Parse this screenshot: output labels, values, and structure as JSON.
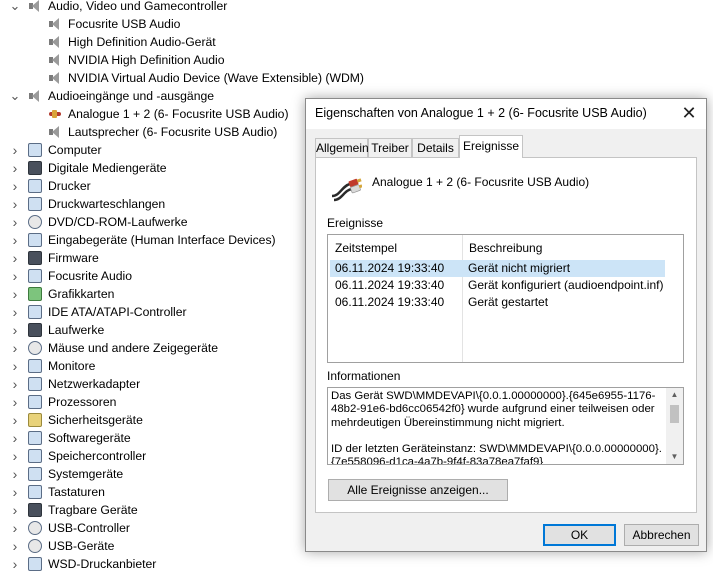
{
  "tree": {
    "items": [
      {
        "label": "Audio, Video und Gamecontroller",
        "chevron": "expanded",
        "icon": "speaker-icon"
      },
      {
        "label": "Focusrite USB Audio",
        "icon": "speaker-icon"
      },
      {
        "label": "High Definition Audio-Gerät",
        "icon": "speaker-icon"
      },
      {
        "label": "NVIDIA High Definition Audio",
        "icon": "speaker-icon"
      },
      {
        "label": "NVIDIA Virtual Audio Device (Wave Extensible) (WDM)",
        "icon": "speaker-icon"
      },
      {
        "label": "Audioeingänge und -ausgänge",
        "chevron": "expanded",
        "icon": "speaker-icon"
      },
      {
        "label": "Analogue 1 + 2 (6- Focusrite USB Audio)",
        "icon": "audio-cable-icon"
      },
      {
        "label": "Lautsprecher (6- Focusrite USB Audio)",
        "icon": "speaker-icon"
      },
      {
        "label": "Computer",
        "chevron": "collapsed",
        "icon": "monitor-icon"
      },
      {
        "label": "Digitale Mediengeräte",
        "chevron": "collapsed",
        "icon": "media-device-icon"
      },
      {
        "label": "Drucker",
        "chevron": "collapsed",
        "icon": "printer-icon"
      },
      {
        "label": "Druckwarteschlangen",
        "chevron": "collapsed",
        "icon": "print-queue-icon"
      },
      {
        "label": "DVD/CD-ROM-Laufwerke",
        "chevron": "collapsed",
        "icon": "disc-drive-icon"
      },
      {
        "label": "Eingabegeräte (Human Interface Devices)",
        "chevron": "collapsed",
        "icon": "hid-icon"
      },
      {
        "label": "Firmware",
        "chevron": "collapsed",
        "icon": "firmware-icon"
      },
      {
        "label": "Focusrite Audio",
        "chevron": "collapsed",
        "icon": "monitor-icon"
      },
      {
        "label": "Grafikkarten",
        "chevron": "collapsed",
        "icon": "graphics-card-icon"
      },
      {
        "label": "IDE ATA/ATAPI-Controller",
        "chevron": "collapsed",
        "icon": "ide-controller-icon"
      },
      {
        "label": "Laufwerke",
        "chevron": "collapsed",
        "icon": "disk-drive-icon"
      },
      {
        "label": "Mäuse und andere Zeigegeräte",
        "chevron": "collapsed",
        "icon": "mouse-icon"
      },
      {
        "label": "Monitore",
        "chevron": "collapsed",
        "icon": "monitor-icon"
      },
      {
        "label": "Netzwerkadapter",
        "chevron": "collapsed",
        "icon": "network-adapter-icon"
      },
      {
        "label": "Prozessoren",
        "chevron": "collapsed",
        "icon": "processor-icon"
      },
      {
        "label": "Sicherheitsgeräte",
        "chevron": "collapsed",
        "icon": "security-device-icon"
      },
      {
        "label": "Softwaregeräte",
        "chevron": "collapsed",
        "icon": "software-device-icon"
      },
      {
        "label": "Speichercontroller",
        "chevron": "collapsed",
        "icon": "storage-controller-icon"
      },
      {
        "label": "Systemgeräte",
        "chevron": "collapsed",
        "icon": "system-device-icon"
      },
      {
        "label": "Tastaturen",
        "chevron": "collapsed",
        "icon": "keyboard-icon"
      },
      {
        "label": "Tragbare Geräte",
        "chevron": "collapsed",
        "icon": "portable-device-icon"
      },
      {
        "label": "USB-Controller",
        "chevron": "collapsed",
        "icon": "usb-icon"
      },
      {
        "label": "USB-Geräte",
        "chevron": "collapsed",
        "icon": "usb-icon"
      },
      {
        "label": "WSD-Druckanbieter",
        "chevron": "collapsed",
        "icon": "printer-icon"
      }
    ]
  },
  "dialog": {
    "title": "Eigenschaften von Analogue 1 + 2 (6- Focusrite USB Audio)",
    "close_glyph": "✕",
    "tabs": [
      {
        "label": "Allgemein",
        "active": false
      },
      {
        "label": "Treiber",
        "active": false
      },
      {
        "label": "Details",
        "active": false
      },
      {
        "label": "Ereignisse",
        "active": true
      }
    ],
    "device_name": "Analogue 1 + 2 (6- Focusrite USB Audio)",
    "events_label": "Ereignisse",
    "columns": [
      "Zeitstempel",
      "Beschreibung"
    ],
    "events": [
      {
        "time": "06.11.2024 19:33:40",
        "desc": "Gerät nicht migriert",
        "selected": true
      },
      {
        "time": "06.11.2024 19:33:40",
        "desc": "Gerät konfiguriert (audioendpoint.inf)",
        "selected": false
      },
      {
        "time": "06.11.2024 19:33:40",
        "desc": "Gerät gestartet",
        "selected": false
      }
    ],
    "info_label": "Informationen",
    "info_text": "Das Gerät SWD\\MMDEVAPI\\{0.0.1.00000000}.{645e6955-1176-48b2-91e6-bd6cc06542f0} wurde aufgrund einer teilweisen oder mehrdeutigen Übereinstimmung nicht migriert.\n\nID der letzten Geräteinstanz: SWD\\MMDEVAPI\\{0.0.0.00000000}.{7e558096-d1ca-4a7b-9f4f-83a78ea7faf9}",
    "show_all_button": "Alle Ereignisse anzeigen...",
    "ok_button": "OK",
    "cancel_button": "Abbrechen",
    "accent_color": "#0078d7",
    "selection_color": "#cce4f7"
  }
}
